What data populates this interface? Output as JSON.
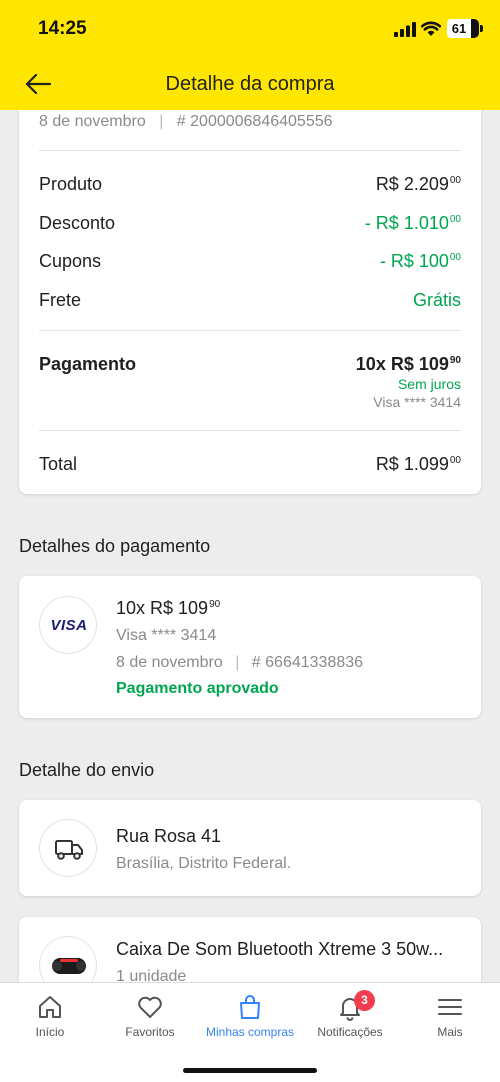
{
  "status_bar": {
    "time": "14:25",
    "battery": "61"
  },
  "header": {
    "title": "Detalhe da compra"
  },
  "summary": {
    "date": "8 de novembro",
    "order_number": "# 2000006846405556",
    "rows": [
      {
        "label": "Produto",
        "value": "R$ 2.209",
        "cents": "00"
      },
      {
        "label": "Desconto",
        "value": "- R$ 1.010",
        "cents": "00"
      },
      {
        "label": "Cupons",
        "value": "- R$ 100",
        "cents": "00"
      },
      {
        "label": "Frete",
        "value": "Grátis"
      }
    ],
    "payment": {
      "label": "Pagamento",
      "value": "10x R$ 109",
      "cents": "90",
      "interest": "Sem juros",
      "card": "Visa **** 3414"
    },
    "total": {
      "label": "Total",
      "value": "R$ 1.099",
      "cents": "00"
    }
  },
  "payment_details": {
    "section_title": "Detalhes do pagamento",
    "card_brand": "VISA",
    "installments": "10x R$ 109",
    "installments_cents": "90",
    "card": "Visa **** 3414",
    "date": "8 de novembro",
    "transaction": "# 66641338836",
    "status": "Pagamento aprovado"
  },
  "shipping": {
    "section_title": "Detalhe do envio",
    "address_line1": "Rua Rosa 41",
    "address_line2": "Brasília, Distrito Federal."
  },
  "product": {
    "name": "Caixa De Som Bluetooth Xtreme 3 50w...",
    "quantity": "1 unidade"
  },
  "tabbar": {
    "items": [
      {
        "label": "Início",
        "icon": "home-icon"
      },
      {
        "label": "Favoritos",
        "icon": "heart-icon"
      },
      {
        "label": "Minhas compras",
        "icon": "bag-icon"
      },
      {
        "label": "Notificações",
        "icon": "bell-icon",
        "badge": "3"
      },
      {
        "label": "Mais",
        "icon": "menu-icon"
      }
    ]
  },
  "colors": {
    "brand_yellow": "#ffe600",
    "green": "#00a650",
    "blue": "#3483fa",
    "badge_red": "#f23d4f"
  }
}
